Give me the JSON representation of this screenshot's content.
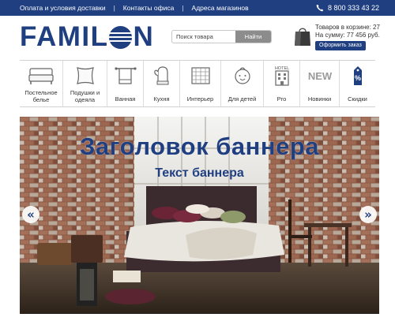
{
  "topbar": {
    "links": [
      "Оплата и условия доставки",
      "Контакты офиса",
      "Адреса магазинов"
    ],
    "separator": "|",
    "phone": "8 800 333 43 22"
  },
  "header": {
    "logo_left": "FAMIL",
    "logo_right": "N",
    "search": {
      "placeholder": "Поиск товара",
      "button": "Найти"
    },
    "cart": {
      "line1": "Товаров в корзине: 27",
      "line2": "На сумму: 77 456 руб.",
      "checkout": "Оформить заказ"
    }
  },
  "nav": {
    "items": [
      {
        "label": "Постельное белье",
        "icon": "bed-icon"
      },
      {
        "label": "Подушки и одеяла",
        "icon": "pillow-icon"
      },
      {
        "label": "Ванная",
        "icon": "towel-rack-icon"
      },
      {
        "label": "Кухня",
        "icon": "oven-mitt-icon"
      },
      {
        "label": "Интерьер",
        "icon": "blanket-icon"
      },
      {
        "label": "Для детей",
        "icon": "baby-icon"
      },
      {
        "label": "Pro",
        "icon": "hotel-icon",
        "icon_text": "HOTEL"
      },
      {
        "label": "Новинки",
        "icon": "new-icon",
        "icon_text": "NEW"
      },
      {
        "label": "Скидки",
        "icon": "discount-tag-icon",
        "icon_text": "%"
      }
    ]
  },
  "banner": {
    "title": "Заголовок баннера",
    "subtitle": "Текст баннера",
    "prev": "«",
    "next": "»"
  },
  "colors": {
    "brand": "#1f3f80",
    "search_button": "#8c8c8c"
  }
}
